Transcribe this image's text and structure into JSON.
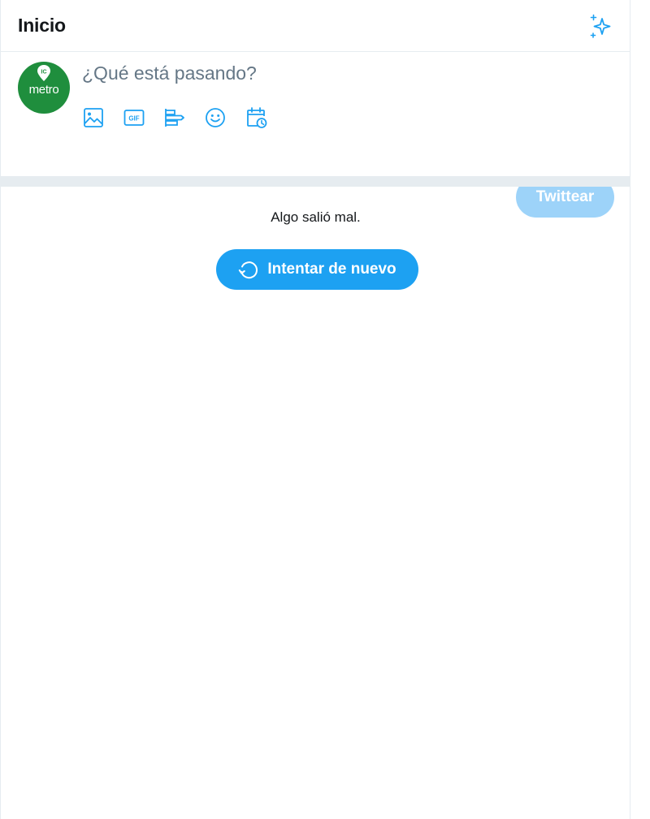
{
  "header": {
    "title": "Inicio",
    "icon": "sparkle-icon"
  },
  "composer": {
    "avatar_text": "metro",
    "avatar_badge": "IC",
    "placeholder": "¿Qué está pasando?",
    "tools": [
      {
        "name": "image-icon"
      },
      {
        "name": "gif-icon",
        "label": "GIF"
      },
      {
        "name": "poll-icon"
      },
      {
        "name": "emoji-icon"
      },
      {
        "name": "schedule-icon"
      }
    ],
    "tweet_button_label": "Twittear"
  },
  "timeline": {
    "error_message": "Algo salió mal.",
    "retry_label": "Intentar de nuevo"
  },
  "colors": {
    "accent": "#1da1f2",
    "accent_disabled": "#9dd3f9",
    "divider": "#e6ecf0",
    "avatar_bg": "#1f8e3d"
  }
}
